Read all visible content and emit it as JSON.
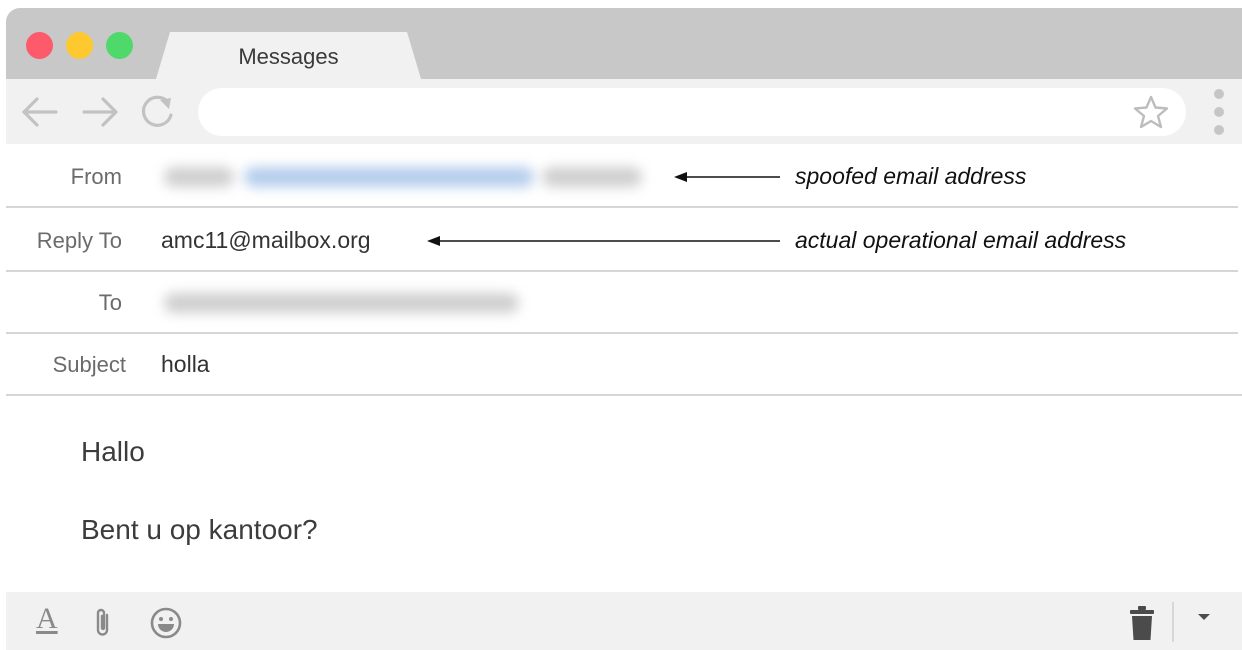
{
  "window": {
    "tab_title": "Messages"
  },
  "toolbar": {
    "back_icon": "arrow-left-icon",
    "forward_icon": "arrow-right-icon",
    "reload_icon": "reload-icon",
    "address_value": "",
    "bookmark_icon": "star-icon",
    "menu_icon": "kebab-menu-icon"
  },
  "headers": {
    "from_label": "From",
    "reply_to_label": "Reply To",
    "reply_to_value": "amc11@mailbox.org",
    "to_label": "To",
    "subject_label": "Subject",
    "subject_value": "holla"
  },
  "annotations": {
    "from_note": "spoofed email address",
    "reply_to_note": "actual operational email address"
  },
  "message": {
    "lines": [
      "Hallo",
      "Bent u op kantoor?"
    ]
  },
  "bottom_toolbar": {
    "format_icon_glyph": "A"
  },
  "colors": {
    "traffic_red": "#fd5a6b",
    "traffic_yellow": "#fec82f",
    "traffic_green": "#4fd96a",
    "chrome_gray": "#c8c8c8",
    "toolbar_gray": "#f1f1f1",
    "icon_gray": "#c2c2c2"
  }
}
